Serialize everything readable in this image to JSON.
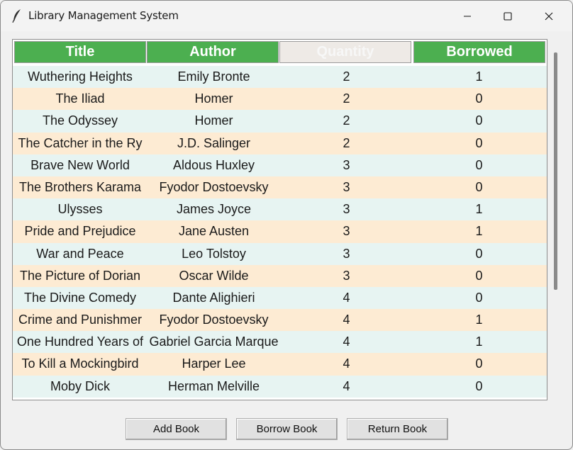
{
  "window": {
    "title": "Library Management System",
    "icon": "feather-icon"
  },
  "table": {
    "columns": [
      "Title",
      "Author",
      "Quantity",
      "Borrowed"
    ],
    "header_color": "#4caf50",
    "row_colors": [
      "#e7f4f2",
      "#fdebd3"
    ],
    "rows": [
      {
        "title": "Wuthering Heights",
        "author": "Emily Bronte",
        "quantity": "2",
        "borrowed": "1"
      },
      {
        "title": "The Iliad",
        "author": "Homer",
        "quantity": "2",
        "borrowed": "0"
      },
      {
        "title": "The Odyssey",
        "author": "Homer",
        "quantity": "2",
        "borrowed": "0"
      },
      {
        "title": "The Catcher in the Ry",
        "author": "J.D. Salinger",
        "quantity": "2",
        "borrowed": "0"
      },
      {
        "title": "Brave New World",
        "author": "Aldous Huxley",
        "quantity": "3",
        "borrowed": "0"
      },
      {
        "title": "The Brothers Karama",
        "author": "Fyodor Dostoevsky",
        "quantity": "3",
        "borrowed": "0"
      },
      {
        "title": "Ulysses",
        "author": "James Joyce",
        "quantity": "3",
        "borrowed": "1"
      },
      {
        "title": "Pride and Prejudice",
        "author": "Jane Austen",
        "quantity": "3",
        "borrowed": "1"
      },
      {
        "title": "War and Peace",
        "author": "Leo Tolstoy",
        "quantity": "3",
        "borrowed": "0"
      },
      {
        "title": "The Picture of Dorian",
        "author": "Oscar Wilde",
        "quantity": "3",
        "borrowed": "0"
      },
      {
        "title": "The Divine Comedy",
        "author": "Dante Alighieri",
        "quantity": "4",
        "borrowed": "0"
      },
      {
        "title": "Crime and Punishmer",
        "author": "Fyodor Dostoevsky",
        "quantity": "4",
        "borrowed": "1"
      },
      {
        "title": "One Hundred Years of",
        "author": "Gabriel Garcia Marque",
        "quantity": "4",
        "borrowed": "1"
      },
      {
        "title": "To Kill a Mockingbird",
        "author": "Harper Lee",
        "quantity": "4",
        "borrowed": "0"
      },
      {
        "title": "Moby Dick",
        "author": "Herman Melville",
        "quantity": "4",
        "borrowed": "0"
      }
    ]
  },
  "buttons": {
    "add": "Add Book",
    "borrow": "Borrow Book",
    "return": "Return Book"
  }
}
